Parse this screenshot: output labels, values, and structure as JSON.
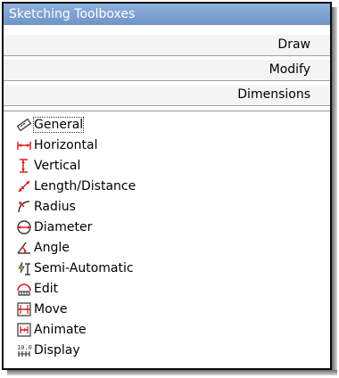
{
  "window": {
    "title": "Sketching Toolboxes"
  },
  "sections": [
    {
      "label": "Draw"
    },
    {
      "label": "Modify"
    },
    {
      "label": "Dimensions"
    }
  ],
  "tools": [
    {
      "label": "General",
      "icon": "general-icon"
    },
    {
      "label": "Horizontal",
      "icon": "horizontal-icon"
    },
    {
      "label": "Vertical",
      "icon": "vertical-icon"
    },
    {
      "label": "Length/Distance",
      "icon": "length-distance-icon"
    },
    {
      "label": "Radius",
      "icon": "radius-icon"
    },
    {
      "label": "Diameter",
      "icon": "diameter-icon"
    },
    {
      "label": "Angle",
      "icon": "angle-icon"
    },
    {
      "label": "Semi-Automatic",
      "icon": "semi-automatic-icon"
    },
    {
      "label": "Edit",
      "icon": "edit-icon"
    },
    {
      "label": "Move",
      "icon": "move-icon"
    },
    {
      "label": "Animate",
      "icon": "animate-icon"
    },
    {
      "label": "Display",
      "icon": "display-icon"
    }
  ],
  "colors": {
    "titlebar": "#7fa2d4",
    "accent_red": "#d81d1d"
  }
}
